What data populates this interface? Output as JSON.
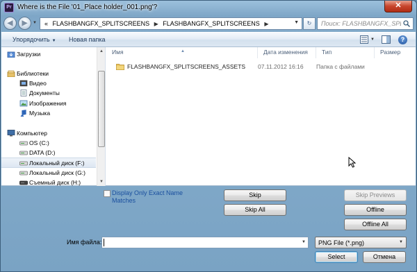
{
  "window": {
    "title": "Where is the File '01_Place holder_001.png'?",
    "close_glyph": "✕",
    "app_icon_text": "Pr"
  },
  "navbar": {
    "back_glyph": "◀",
    "forward_glyph": "▶",
    "breadcrumb": {
      "prefix": "«",
      "parts": [
        "FLASHBANGFX_SPLITSCREENS",
        "FLASHBANGFX_SPLITSCREENS"
      ],
      "separator": "▶"
    },
    "refresh_glyph": "↻",
    "search_placeholder": "Поиск: FLASHBANGFX_SPLITSC..."
  },
  "toolbar": {
    "organize_label": "Упорядочить",
    "new_folder_label": "Новая папка",
    "help_glyph": "?"
  },
  "nav_tree": [
    {
      "label": "Загрузки",
      "icon": "downloads-icon",
      "selected": false
    },
    {
      "label": "Библиотеки",
      "icon": "libraries-icon",
      "selected": false
    },
    {
      "label": "Видео",
      "icon": "video-icon",
      "selected": false
    },
    {
      "label": "Документы",
      "icon": "documents-icon",
      "selected": false
    },
    {
      "label": "Изображения",
      "icon": "pictures-icon",
      "selected": false
    },
    {
      "label": "Музыка",
      "icon": "music-icon",
      "selected": false
    },
    {
      "label": "Компьютер",
      "icon": "computer-icon",
      "selected": false
    },
    {
      "label": "OS (C:)",
      "icon": "drive-icon",
      "selected": false
    },
    {
      "label": "DATA (D:)",
      "icon": "drive-icon",
      "selected": false
    },
    {
      "label": "Локальный диск (F:)",
      "icon": "drive-icon",
      "selected": true
    },
    {
      "label": "Локальный диск (G:)",
      "icon": "drive-icon",
      "selected": false
    },
    {
      "label": "Съемный диск (H:)",
      "icon": "removable-drive-icon",
      "selected": false
    }
  ],
  "columns": {
    "name": "Имя",
    "date": "Дата изменения",
    "type": "Тип",
    "size": "Размер"
  },
  "files": [
    {
      "name": "FLASHBANGFX_SPLITSCREENS_ASSETS",
      "date": "07.11.2012 16:16",
      "type": "Папка с файлами",
      "size": ""
    }
  ],
  "options": {
    "display_exact_label": "Display Only Exact Name Matches"
  },
  "buttons": {
    "skip": "Skip",
    "skip_all": "Skip All",
    "skip_previews": "Skip Previews",
    "offline": "Offline",
    "offline_all": "Offline All",
    "select": "Select",
    "cancel": "Отмена"
  },
  "filename": {
    "label": "Имя файла:",
    "value": ""
  },
  "filetype": {
    "selected": "PNG File (*.png)"
  },
  "colors": {
    "titlebar": "#9cc0dc",
    "close": "#c7442c",
    "link": "#1a4f9e"
  }
}
